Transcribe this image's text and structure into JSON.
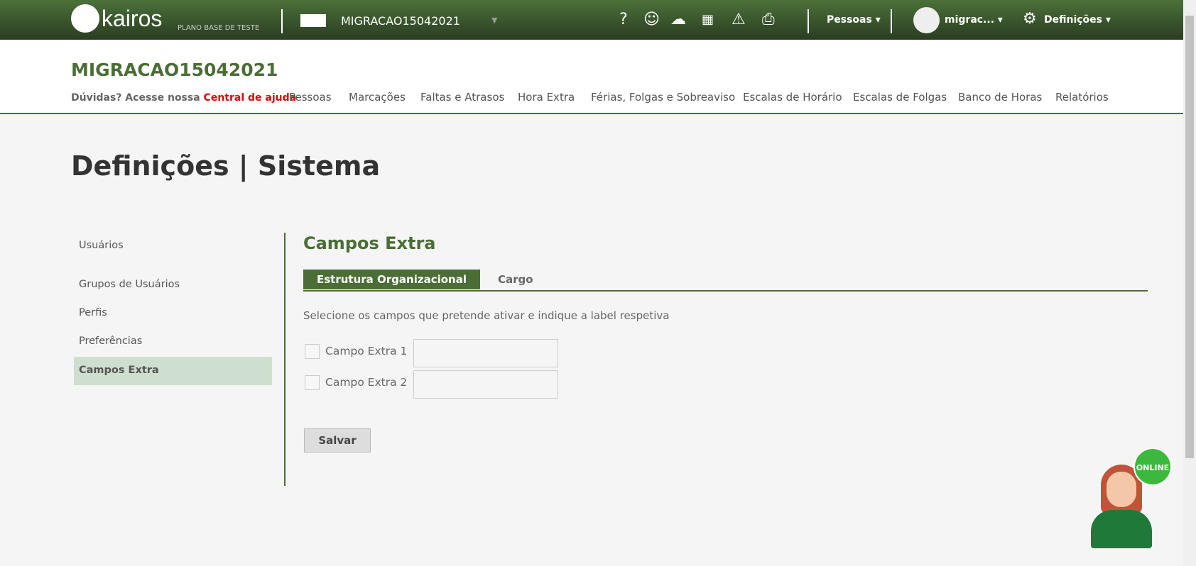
{
  "topbar": {
    "logo_text": "kairos",
    "plan": "PLANO BASE DE TESTE",
    "company": "MIGRACAO15042021",
    "pessoas": "Pessoas",
    "user": "migrac...",
    "definicoes": "Definições",
    "icons": [
      "help-icon",
      "support-chat-icon",
      "cloud-download-icon",
      "calculator-icon",
      "warning-icon",
      "inbox-icon"
    ]
  },
  "header": {
    "title": "MIGRACAO15042021",
    "help_prefix": "Dúvidas? Acesse nossa",
    "help_link": "Central de ajuda",
    "nav": [
      "Pessoas",
      "Marcações",
      "Faltas e Atrasos",
      "Hora Extra",
      "Férias, Folgas e Sobreaviso",
      "Escalas de Horário",
      "Escalas de Folgas",
      "Banco de Horas",
      "Relatórios"
    ]
  },
  "page": {
    "title": "Definições | Sistema"
  },
  "sidebar": {
    "items": [
      "Usuários",
      "Grupos de Usuários",
      "Perfis",
      "Preferências",
      "Campos Extra"
    ],
    "active": "Campos Extra"
  },
  "content": {
    "title": "Campos Extra",
    "tabs": [
      "Estrutura Organizacional",
      "Cargo"
    ],
    "description": "Selecione os campos que pretende ativar e indique a label respetiva",
    "fields": [
      {
        "label": "Campo Extra 1",
        "value": "",
        "checked": false
      },
      {
        "label": "Campo Extra 2",
        "value": "",
        "checked": false
      }
    ],
    "save": "Salvar"
  },
  "chat": {
    "status": "ONLINE"
  },
  "colors": {
    "brand": "#4a6e35",
    "link": "#e00000"
  }
}
